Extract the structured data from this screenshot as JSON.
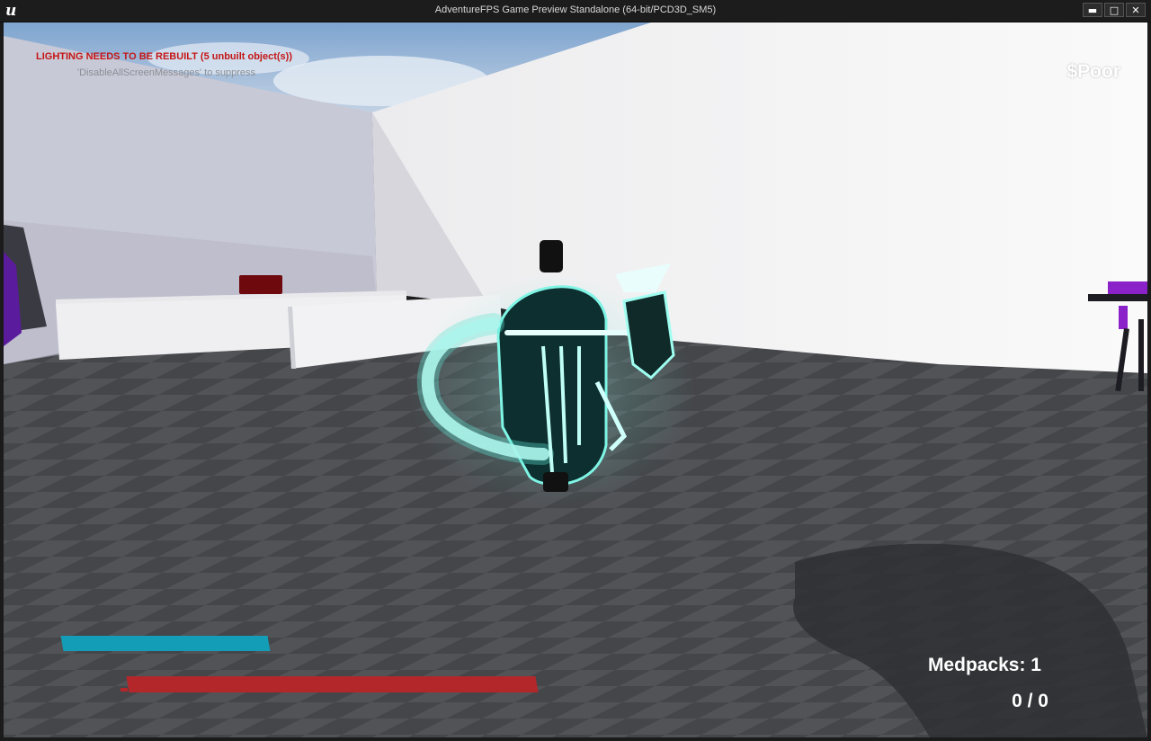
{
  "window": {
    "title": "AdventureFPS Game Preview Standalone (64-bit/PCD3D_SM5)",
    "logo_text": "u",
    "buttons": {
      "minimize": "▬",
      "maximize": "□",
      "close": "✕"
    }
  },
  "debug": {
    "lighting_warning": "LIGHTING NEEDS TO BE REBUILT (5 unbuilt object(s))",
    "suppress_hint": "'DisableAllScreenMessages' to suppress"
  },
  "hud": {
    "money": "$Poor",
    "medpacks": "Medpacks: 1",
    "ammo": "0 / 0"
  },
  "colors": {
    "shield_bar": "#149db6",
    "health_bar": "#b3272b",
    "warning_text": "#c41616",
    "weapon_glow": "#7ff5e6"
  }
}
